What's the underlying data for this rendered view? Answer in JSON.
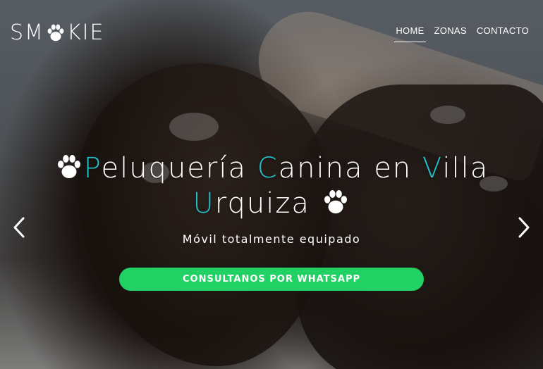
{
  "brand": {
    "logo_left": "SM",
    "logo_right": "KIE",
    "logo_icon": "paw-icon"
  },
  "nav": {
    "items": [
      {
        "label": "HOME",
        "active": true
      },
      {
        "label": "ZONAS",
        "active": false
      },
      {
        "label": "CONTACTO",
        "active": false
      }
    ]
  },
  "hero": {
    "title_line1": [
      {
        "cap": "P",
        "rest": "eluquería "
      },
      {
        "cap": "C",
        "rest": "anina en "
      },
      {
        "cap": "V",
        "rest": "illa"
      }
    ],
    "title_line2": {
      "cap": "U",
      "rest": "rquiza"
    },
    "subtitle": "Móvil totalmente equipado",
    "cta_label": "CONSULTANOS POR WHATSAPP"
  },
  "colors": {
    "accent": "#22c1c9",
    "cta": "#22d164"
  }
}
